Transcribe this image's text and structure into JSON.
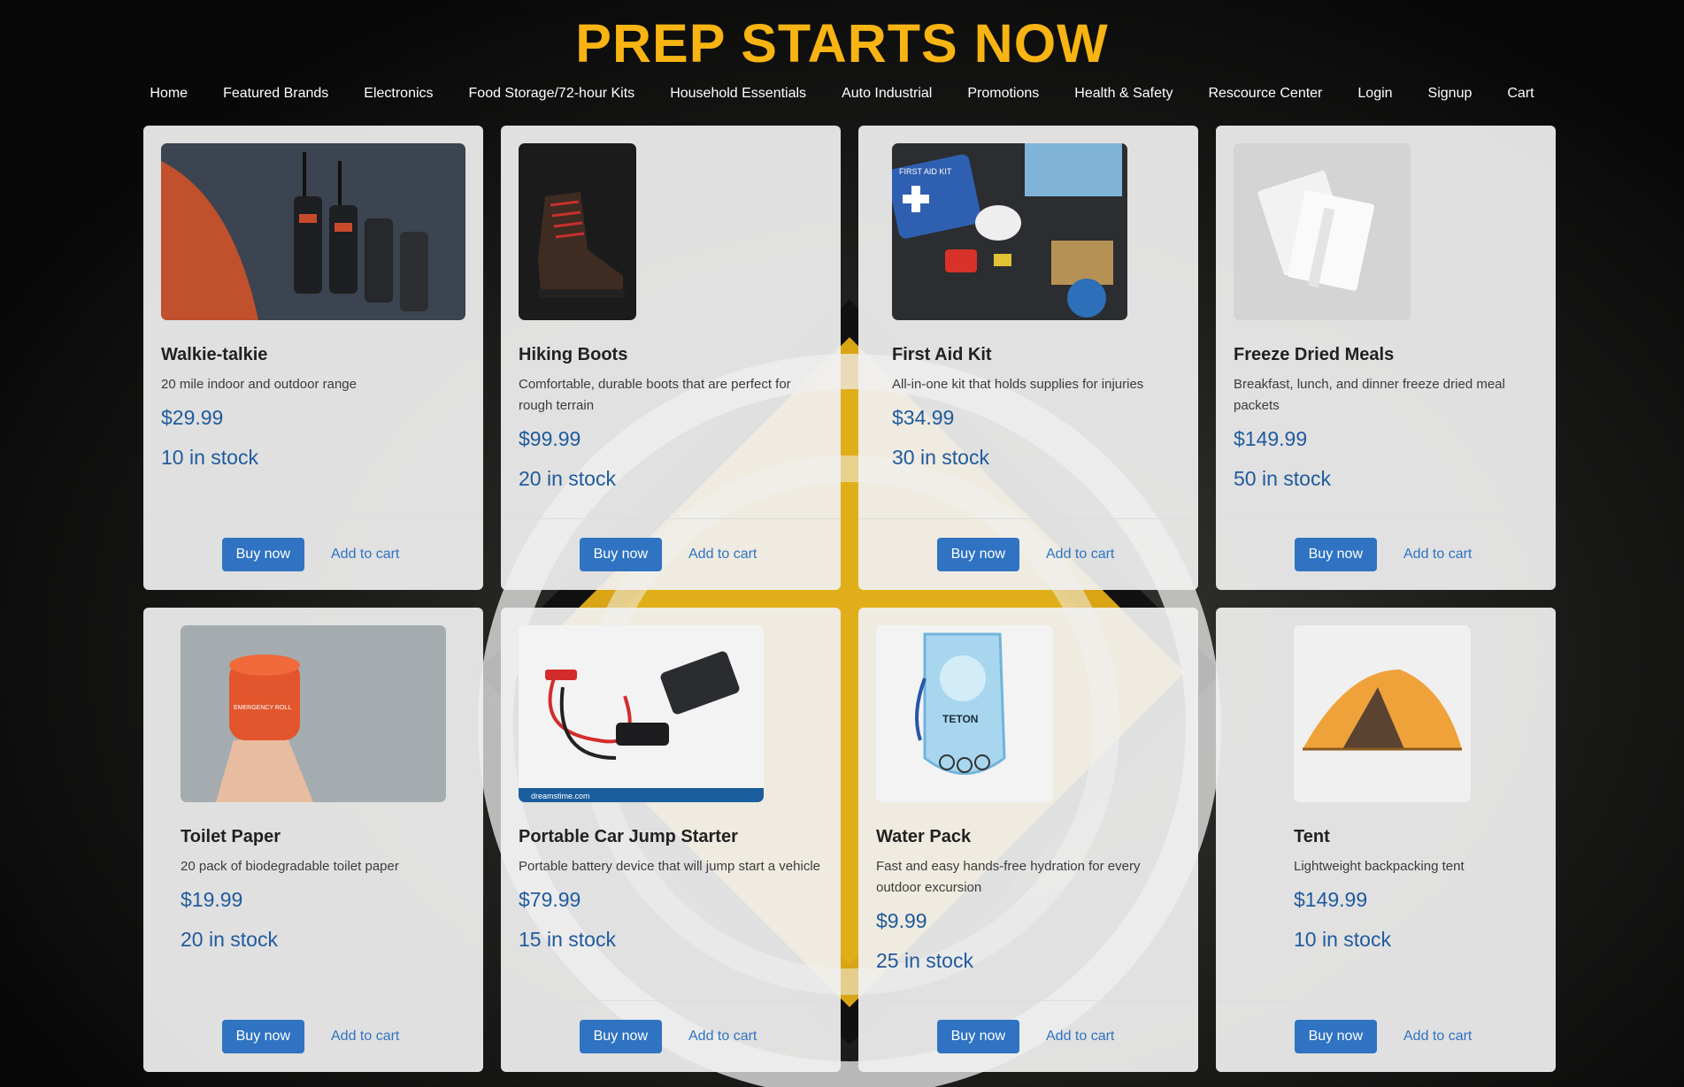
{
  "site": {
    "title": "PREP STARTS NOW"
  },
  "nav": [
    {
      "label": "Home"
    },
    {
      "label": "Featured Brands"
    },
    {
      "label": "Electronics"
    },
    {
      "label": "Food Storage/72-hour Kits"
    },
    {
      "label": "Household Essentials"
    },
    {
      "label": "Auto Industrial"
    },
    {
      "label": "Promotions"
    },
    {
      "label": "Health & Safety"
    },
    {
      "label": "Rescource Center"
    },
    {
      "label": "Login"
    },
    {
      "label": "Signup"
    },
    {
      "label": "Cart"
    }
  ],
  "products": [
    {
      "name": "Walkie-talkie",
      "description": "20 mile indoor and outdoor range",
      "price": "$29.99",
      "stock": "10 in stock",
      "image_icon": "walkie-talkie-photo"
    },
    {
      "name": "Hiking Boots",
      "description": "Comfortable, durable boots that are perfect for rough terrain",
      "price": "$99.99",
      "stock": "20 in stock",
      "image_icon": "hiking-boot-photo"
    },
    {
      "name": "First Aid Kit",
      "description": "All-in-one kit that holds supplies for injuries",
      "price": "$34.99",
      "stock": "30 in stock",
      "image_icon": "first-aid-kit-photo",
      "image_text": "FIRST AID KIT"
    },
    {
      "name": "Freeze Dried Meals",
      "description": "Breakfast, lunch, and dinner freeze dried meal packets",
      "price": "$149.99",
      "stock": "50 in stock",
      "image_icon": "meal-packets-photo"
    },
    {
      "name": "Toilet Paper",
      "description": "20 pack of biodegradable toilet paper",
      "price": "$19.99",
      "stock": "20 in stock",
      "image_icon": "toilet-paper-photo",
      "image_text": "EMERGENCY ROLL"
    },
    {
      "name": "Portable Car Jump Starter",
      "description": "Portable battery device that will jump start a vehicle",
      "price": "$79.99",
      "stock": "15 in stock",
      "image_icon": "jump-starter-photo",
      "image_text": "dreamstime.com"
    },
    {
      "name": "Water Pack",
      "description": "Fast and easy hands-free hydration for every outdoor excursion",
      "price": "$9.99",
      "stock": "25 in stock",
      "image_icon": "water-pack-photo",
      "image_text": "TETON"
    },
    {
      "name": "Tent",
      "description": "Lightweight backpacking tent",
      "price": "$149.99",
      "stock": "10 in stock",
      "image_icon": "tent-photo"
    }
  ],
  "buttons": {
    "buy_label": "Buy now",
    "cart_label": "Add to cart"
  },
  "colors": {
    "title": "#f7b412",
    "link": "#2f73c2",
    "button": "#2f73c2"
  }
}
